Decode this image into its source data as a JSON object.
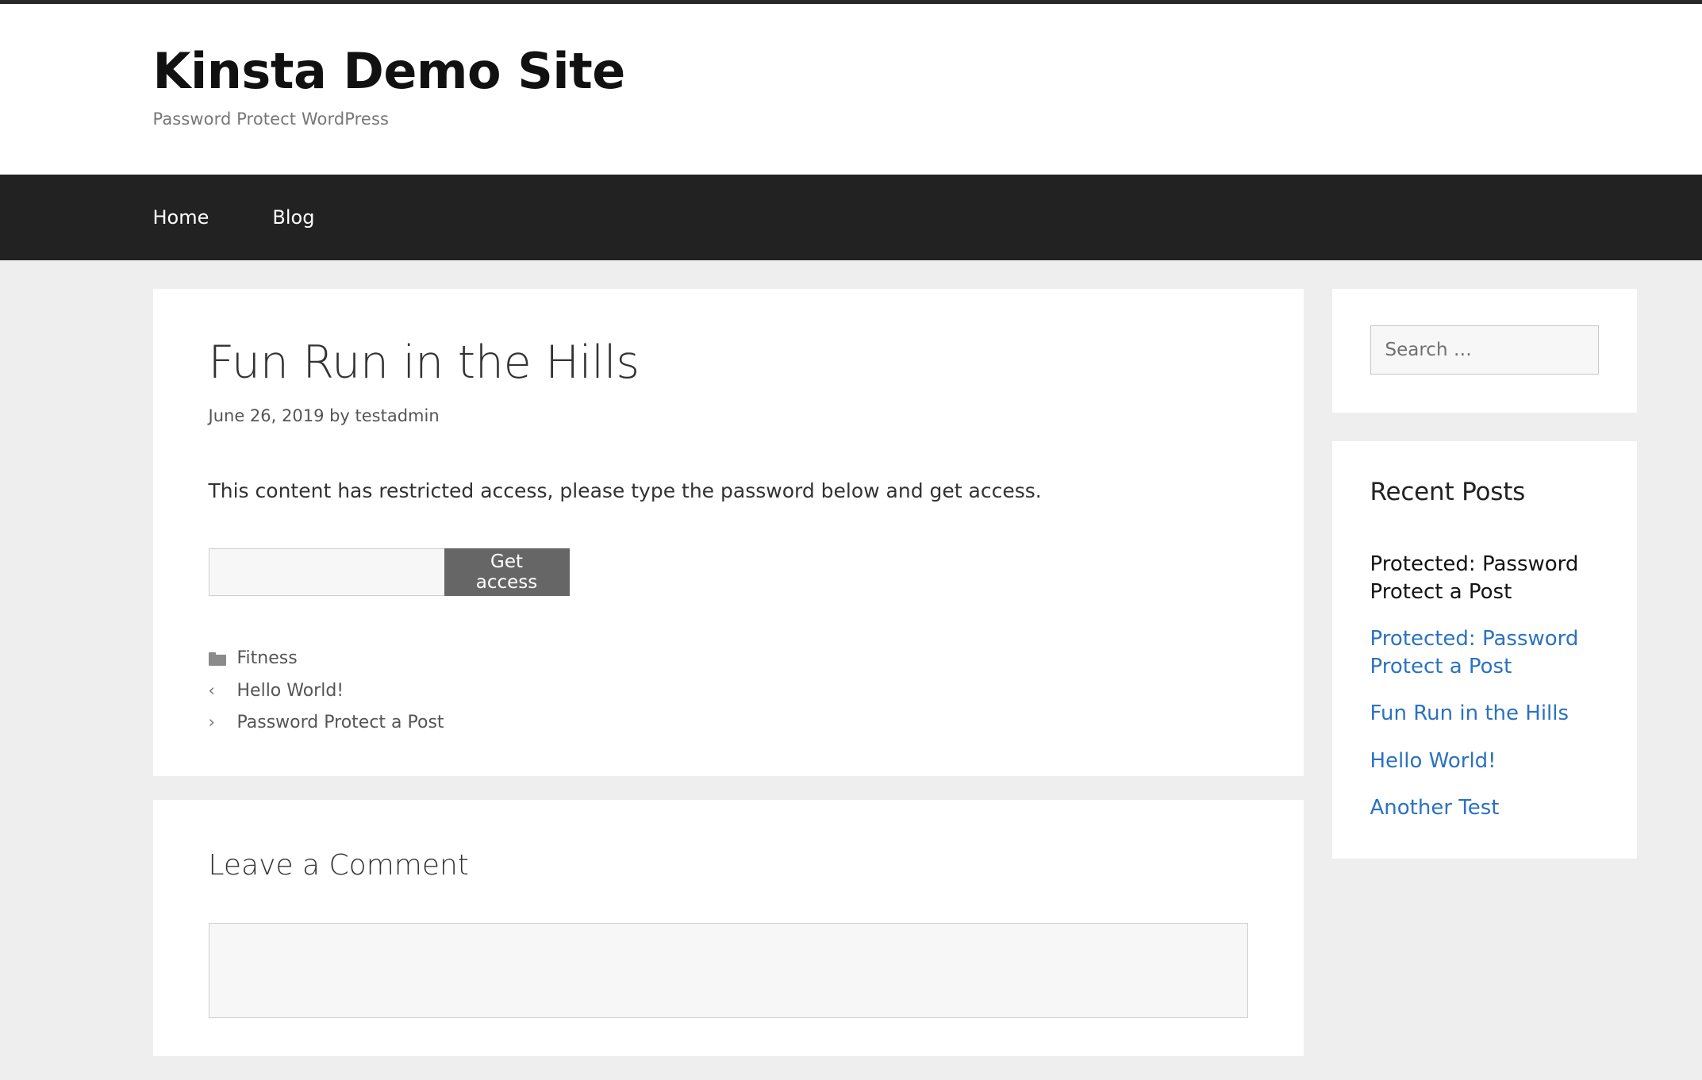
{
  "site": {
    "title": "Kinsta Demo Site",
    "description": "Password Protect WordPress"
  },
  "nav": {
    "items": [
      {
        "label": "Home"
      },
      {
        "label": "Blog"
      }
    ]
  },
  "post": {
    "title": "Fun Run in the Hills",
    "meta": "June 26, 2019 by testadmin",
    "protected_message": "This content has restricted access, please type the password below and get access.",
    "password_value": "",
    "password_placeholder": "",
    "submit_label": "Get access",
    "category": "Fitness",
    "prev_link": "Hello World!",
    "next_link": "Password Protect a Post",
    "prev_arrow": "‹",
    "next_arrow": "›"
  },
  "comments": {
    "title": "Leave a Comment",
    "textarea_value": "",
    "textarea_placeholder": ""
  },
  "sidebar": {
    "search": {
      "placeholder": "Search …",
      "value": ""
    },
    "recent_posts": {
      "title": "Recent Posts",
      "items": [
        {
          "label": "Protected: Password Protect a Post",
          "current": true
        },
        {
          "label": "Protected: Password Protect a Post",
          "current": false
        },
        {
          "label": "Fun Run in the Hills",
          "current": false
        },
        {
          "label": "Hello World!",
          "current": false
        },
        {
          "label": "Another Test",
          "current": false
        }
      ]
    }
  },
  "colors": {
    "nav_background": "#222222",
    "page_background": "#eeeeee",
    "link_blue": "#2b72c0",
    "button_gray": "#666666"
  }
}
